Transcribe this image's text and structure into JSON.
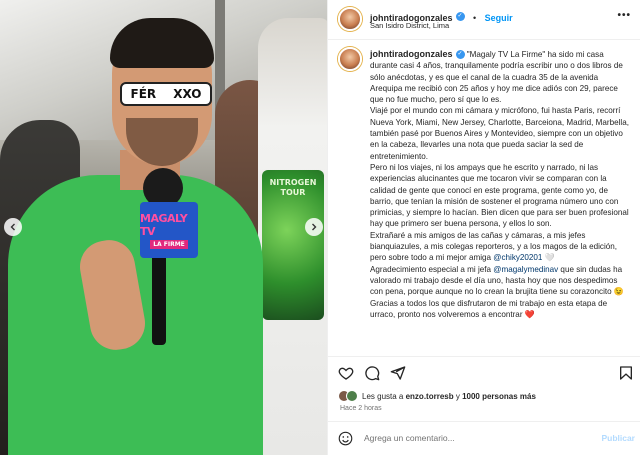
{
  "photo": {
    "glasses_text": [
      "FÉR",
      "XXO"
    ],
    "mic_flag_title": "MAGALY TV",
    "mic_flag_subtitle": "LA FIRME",
    "shirt_print_text": "NITROGEN TOUR",
    "prev_icon": "chevron-left-icon",
    "next_icon": "chevron-right-icon"
  },
  "header": {
    "username": "johntiradogonzales",
    "follow_label": "Seguir",
    "separator": "•",
    "location": "San Isidro District, Lima",
    "more_icon": "more-horizontal-icon"
  },
  "caption": {
    "username": "johntiradogonzales",
    "p1": "\"Magaly TV La Firme\" ha sido mi casa durante casi 4 años, tranquilamente podría escribir uno o dos libros de sólo anécdotas, y es que el canal de la cuadra 35 de la avenida Arequipa me recibió con 25 años y hoy me dice adiós con 29, parece que no fue mucho, pero sí que lo es.",
    "p2": "Viajé por el mundo con mi cámara y micrófono, fui hasta Paris, recorrí Nueva York, Miami, New Jersey, Charlotte, Barceiona, Madrid, Marbella, también pasé por Buenos Aires y Montevideo, siempre con un objetivo en la cabeza, llevarles una nota que pueda saciar la sed de entretenimiento.",
    "p3": "Pero ni los viajes, ni los ampays que he escrito y narrado, ni las experiencias alucinantes que me tocaron vivir se comparan con la calidad de gente que conocí en este programa, gente como yo, de barrio, que tenían la misión de sostener el programa número uno con primicias, y siempre lo hacían. Bien dicen que para ser buen profesional hay que primero ser buena persona, y ellos lo son.",
    "p4_a": "Extrañaré a mis amigos de las cañas y cámaras, a mis jefes bianquiazules, a mis colegas reporteros, y a los magos de la edición, pero sobre todo a mi mejor amiga ",
    "p4_mention": "@chiky20201",
    "p4_emoji": "🤍",
    "p5_a": "Agradecimiento especial a mi jefa ",
    "p5_mention": "@magalymedinav",
    "p5_b": " que sin dudas ha valorado mi trabajo desde el día uno, hasta hoy que nos despedimos con pena, porque aunque no lo crean la brujita tiene su corazoncito ",
    "p5_emoji": "😉",
    "p6": "Gracias a todos los que disfrutaron de mi trabajo en esta etapa de urraco, pronto nos volveremos a encontrar ",
    "p6_emoji": "❤️"
  },
  "actions": {
    "like_icon": "heart-icon",
    "comment_icon": "comment-icon",
    "share_icon": "share-icon",
    "save_icon": "bookmark-icon"
  },
  "likes": {
    "prefix": "Les gusta a ",
    "user": "enzo.torresb",
    "middle": " y ",
    "count": "1000 personas más"
  },
  "time": "Hace 2 horas",
  "comment": {
    "emoji_icon": "smiley-icon",
    "placeholder": "Agrega un comentario...",
    "post_label": "Publicar"
  },
  "colors": {
    "link_blue": "#0095f6",
    "mention_blue": "#00376b",
    "verified_blue": "#3897f0",
    "heart_red": "#ed4956",
    "shirt_green": "#3dbd55"
  }
}
